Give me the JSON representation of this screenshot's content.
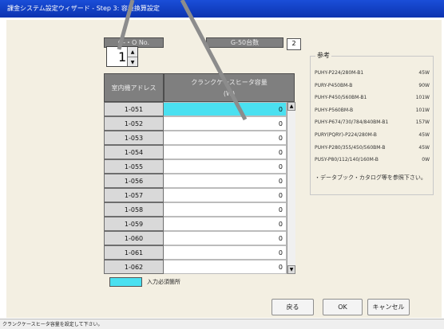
{
  "window": {
    "title": "課金システム設定ウィザード - Step 3: 容量換算設定"
  },
  "group": {
    "no_label": "G-・O No.",
    "count_label": "G-50台数",
    "count_value": "2",
    "spin_value": "1"
  },
  "table": {
    "header_address": "室内機アドレス",
    "header_capacity": "クランクケースヒータ容量",
    "header_unit": "(W)",
    "rows": [
      {
        "address": "1-051",
        "value": "0"
      },
      {
        "address": "1-052",
        "value": "0"
      },
      {
        "address": "1-053",
        "value": "0"
      },
      {
        "address": "1-054",
        "value": "0"
      },
      {
        "address": "1-055",
        "value": "0"
      },
      {
        "address": "1-056",
        "value": "0"
      },
      {
        "address": "1-057",
        "value": "0"
      },
      {
        "address": "1-058",
        "value": "0"
      },
      {
        "address": "1-059",
        "value": "0"
      },
      {
        "address": "1-060",
        "value": "0"
      },
      {
        "address": "1-061",
        "value": "0"
      },
      {
        "address": "1-062",
        "value": "0"
      }
    ]
  },
  "reference": {
    "title": "参考",
    "items": [
      {
        "model": "PUHY-P224/280M-B1",
        "power": "45W"
      },
      {
        "model": "PURY-P450BM-B",
        "power": "90W"
      },
      {
        "model": "PUHY-P450/560BM-B1",
        "power": "101W"
      },
      {
        "model": "PUHY-P560BM-B",
        "power": "101W"
      },
      {
        "model": "PUHY-P674/730/784/840BM-B1",
        "power": "157W"
      },
      {
        "model": "PURY(PQRY)-P224/280M-B",
        "power": "45W"
      },
      {
        "model": "PUHY-P280/355/450/560BM-B",
        "power": "45W"
      },
      {
        "model": "PUSY-P80/112/140/160M-B",
        "power": "0W"
      }
    ],
    "note": "・データブック・カタログ等を参照下さい。"
  },
  "legend": {
    "label": "入力必須箇所",
    "color": "#4ae0f0"
  },
  "buttons": {
    "back": "戻る",
    "ok": "OK",
    "cancel": "キャンセル"
  },
  "status": {
    "text": "クランクケースヒータ容量を設定して下さい。"
  },
  "colors": {
    "titlebar": "#1a4ed8",
    "header_gray": "#7f7f7f",
    "background": "#f3efe2"
  }
}
